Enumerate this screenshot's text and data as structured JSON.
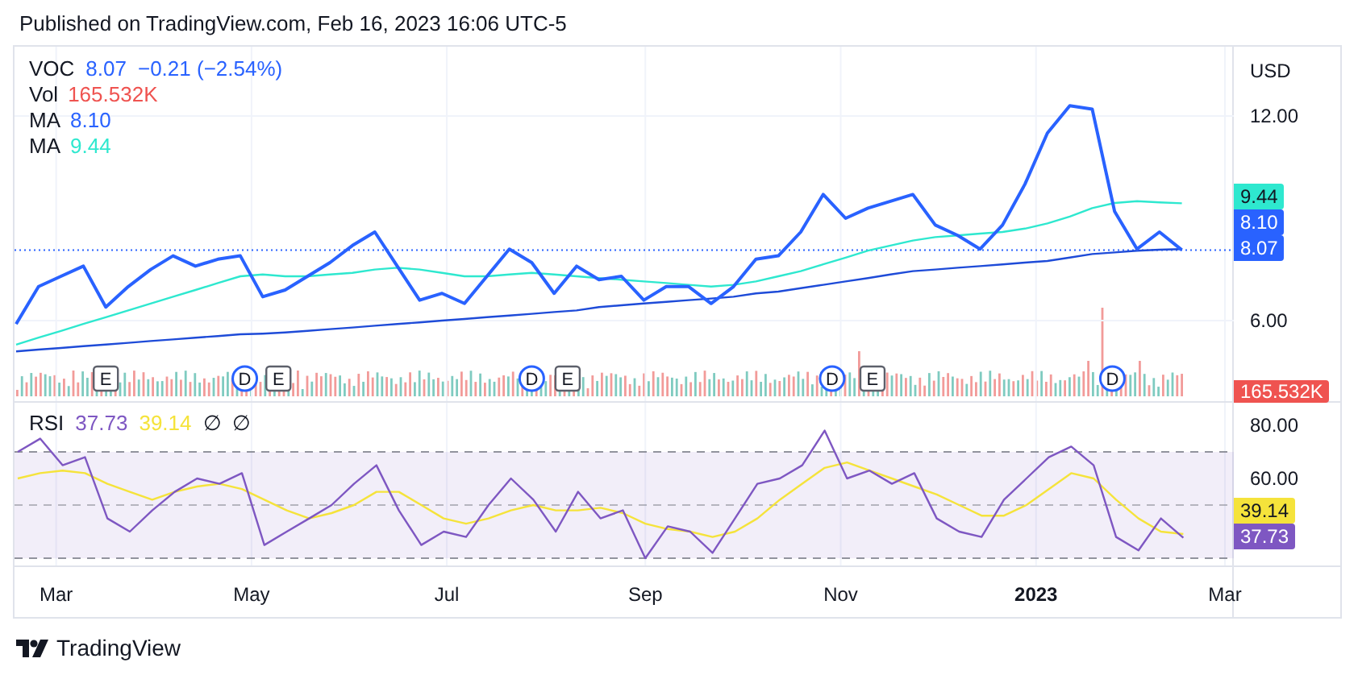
{
  "published": "Published on TradingView.com, Feb 16, 2023 16:06 UTC-5",
  "legend": {
    "symbol": "VOC",
    "last": "8.07",
    "change": "−0.21 (−2.54%)",
    "color": "#2962ff"
  },
  "indicators": [
    {
      "label": "Vol",
      "value": "165.532K",
      "color": "#ef5350"
    },
    {
      "label": "MA",
      "value": "8.10",
      "color": "#2962ff"
    },
    {
      "label": "MA",
      "value": "9.44",
      "color": "#2ee8cf"
    }
  ],
  "currency": "USD",
  "price_chart": {
    "chart_data": {
      "type": "line",
      "series": [
        {
          "color": "#2962ff",
          "values": [
            5.9,
            7.0,
            7.3,
            7.6,
            6.4,
            7.0,
            7.5,
            7.9,
            7.6,
            7.8,
            7.9,
            6.7,
            6.9,
            7.3,
            7.7,
            8.2,
            8.6,
            7.6,
            6.6,
            6.8,
            6.5,
            7.3,
            8.1,
            7.7,
            6.8,
            7.6,
            7.2,
            7.3,
            6.6,
            7.0,
            7.0,
            6.5,
            7.0,
            7.8,
            7.9,
            8.6,
            9.7,
            9.0,
            9.3,
            9.5,
            9.7,
            8.8,
            8.5,
            8.1,
            8.8,
            10.0,
            11.5,
            12.3,
            12.2,
            9.2,
            8.1,
            8.6,
            8.07
          ]
        },
        {
          "color": "#1e4bd8",
          "values": [
            5.1,
            5.15,
            5.2,
            5.25,
            5.3,
            5.35,
            5.4,
            5.45,
            5.5,
            5.55,
            5.6,
            5.62,
            5.65,
            5.7,
            5.75,
            5.8,
            5.85,
            5.9,
            5.95,
            6.0,
            6.05,
            6.1,
            6.15,
            6.2,
            6.25,
            6.3,
            6.4,
            6.45,
            6.5,
            6.55,
            6.6,
            6.65,
            6.7,
            6.8,
            6.85,
            6.95,
            7.05,
            7.15,
            7.25,
            7.35,
            7.45,
            7.5,
            7.55,
            7.6,
            7.65,
            7.7,
            7.75,
            7.85,
            7.95,
            8.0,
            8.05,
            8.08,
            8.1
          ]
        },
        {
          "color": "#2ee8cf",
          "values": [
            5.3,
            5.5,
            5.7,
            5.9,
            6.1,
            6.3,
            6.5,
            6.7,
            6.9,
            7.1,
            7.3,
            7.35,
            7.3,
            7.3,
            7.35,
            7.4,
            7.5,
            7.55,
            7.5,
            7.4,
            7.3,
            7.3,
            7.35,
            7.4,
            7.35,
            7.3,
            7.25,
            7.2,
            7.15,
            7.1,
            7.05,
            7.0,
            7.05,
            7.15,
            7.3,
            7.45,
            7.65,
            7.85,
            8.05,
            8.2,
            8.35,
            8.45,
            8.5,
            8.55,
            8.6,
            8.7,
            8.85,
            9.05,
            9.3,
            9.45,
            9.5,
            9.47,
            9.44
          ]
        }
      ],
      "ylim": [
        3.64,
        14.03
      ],
      "yticks": [
        {
          "value": 6,
          "label": "6.00"
        },
        {
          "value": 12,
          "label": "12.00"
        }
      ],
      "grid": true,
      "ref_lines": [
        {
          "axis": "y",
          "value": 8.07
        }
      ],
      "annotations": [
        "E",
        "D",
        "E",
        "D",
        "E",
        "D",
        "E",
        "D"
      ]
    }
  },
  "event_markers": [
    {
      "kind": "earnings"
    },
    {
      "kind": "dividend"
    },
    {
      "kind": "earnings"
    },
    {
      "kind": "dividend"
    },
    {
      "kind": "earnings"
    },
    {
      "kind": "dividend"
    },
    {
      "kind": "earnings"
    },
    {
      "kind": "dividend"
    }
  ],
  "price_badges": [
    {
      "text": "9.44",
      "color": "#2ee8cf"
    },
    {
      "text": "8.10",
      "color": "#2962ff"
    },
    {
      "text": "8.07",
      "color": "#2962ff"
    }
  ],
  "volume_badge": {
    "text": "165.532K",
    "color": "#ef5350"
  },
  "rsi": {
    "label": "RSI",
    "value": "37.73",
    "ma_value": "39.14",
    "extras": [
      "∅",
      "∅"
    ]
  },
  "rsi_chart": {
    "chart_data": {
      "type": "line",
      "x": [
        "2022-02-17",
        "2022-02-24",
        "2022-03-03",
        "2022-03-10",
        "2022-03-17",
        "2022-03-24",
        "2022-03-31",
        "2022-04-07",
        "2022-04-14",
        "2022-04-21",
        "2022-04-28",
        "2022-05-05",
        "2022-05-12",
        "2022-05-19",
        "2022-05-26",
        "2022-06-02",
        "2022-06-09",
        "2022-06-16",
        "2022-06-23",
        "2022-06-30",
        "2022-07-07",
        "2022-07-14",
        "2022-07-21",
        "2022-07-28",
        "2022-08-04",
        "2022-08-11",
        "2022-08-18",
        "2022-08-25",
        "2022-09-01",
        "2022-09-08",
        "2022-09-15",
        "2022-09-22",
        "2022-09-29",
        "2022-10-06",
        "2022-10-13",
        "2022-10-20",
        "2022-10-27",
        "2022-11-03",
        "2022-11-10",
        "2022-11-17",
        "2022-11-24",
        "2022-12-01",
        "2022-12-08",
        "2022-12-15",
        "2022-12-22",
        "2022-12-29",
        "2023-01-05",
        "2023-01-12",
        "2023-01-19",
        "2023-01-26",
        "2023-02-02",
        "2023-02-09",
        "2023-02-16"
      ],
      "series": [
        {
          "color": "#7e57c2",
          "values": [
            70,
            75,
            65,
            68,
            45,
            40,
            48,
            55,
            60,
            58,
            62,
            35,
            40,
            45,
            50,
            58,
            65,
            48,
            35,
            40,
            38,
            50,
            60,
            52,
            40,
            55,
            45,
            48,
            30,
            42,
            40,
            32,
            45,
            58,
            60,
            65,
            78,
            60,
            63,
            58,
            62,
            45,
            40,
            38,
            52,
            60,
            68,
            72,
            65,
            38,
            33,
            45,
            37.7
          ]
        },
        {
          "color": "#f5e33b",
          "values": [
            60,
            62,
            63,
            62,
            58,
            55,
            52,
            55,
            57,
            58,
            56,
            52,
            48,
            45,
            47,
            50,
            55,
            55,
            50,
            45,
            43,
            45,
            48,
            50,
            48,
            48,
            49,
            47,
            43,
            41,
            40,
            38,
            40,
            45,
            52,
            58,
            64,
            66,
            63,
            60,
            57,
            54,
            50,
            46,
            46,
            50,
            56,
            62,
            60,
            52,
            45,
            40,
            39.1
          ]
        }
      ],
      "ylim": [
        27.3,
        88.5
      ],
      "xlim": [
        "2022-02-16",
        "2023-04-06"
      ],
      "grid": true,
      "ref_lines": [
        {
          "axis": "y",
          "value": 70
        },
        {
          "axis": "y",
          "value": 50
        },
        {
          "axis": "y",
          "value": 30
        }
      ],
      "bands": [
        {
          "axis": "y",
          "from": 30,
          "to": 70
        }
      ],
      "yticks": [
        {
          "value": 60,
          "label": "60.00"
        },
        {
          "value": 80,
          "label": "80.00"
        }
      ],
      "xticks": [
        {
          "value": "2022-03-01",
          "label": "Mar"
        },
        {
          "value": "2022-05-01",
          "label": "May"
        },
        {
          "value": "2022-07-01",
          "label": "Jul"
        },
        {
          "value": "2022-09-01",
          "label": "Sep"
        },
        {
          "value": "2022-11-01",
          "label": "Nov"
        },
        {
          "value": "2023-01-01",
          "label": "2023"
        },
        {
          "value": "2023-03-01",
          "label": "Mar"
        }
      ]
    }
  },
  "rsi_badges": [
    {
      "text": "39.14",
      "color": "#f5e33b"
    },
    {
      "text": "37.73",
      "color": "#7e57c2"
    }
  ],
  "brand": "TradingView"
}
